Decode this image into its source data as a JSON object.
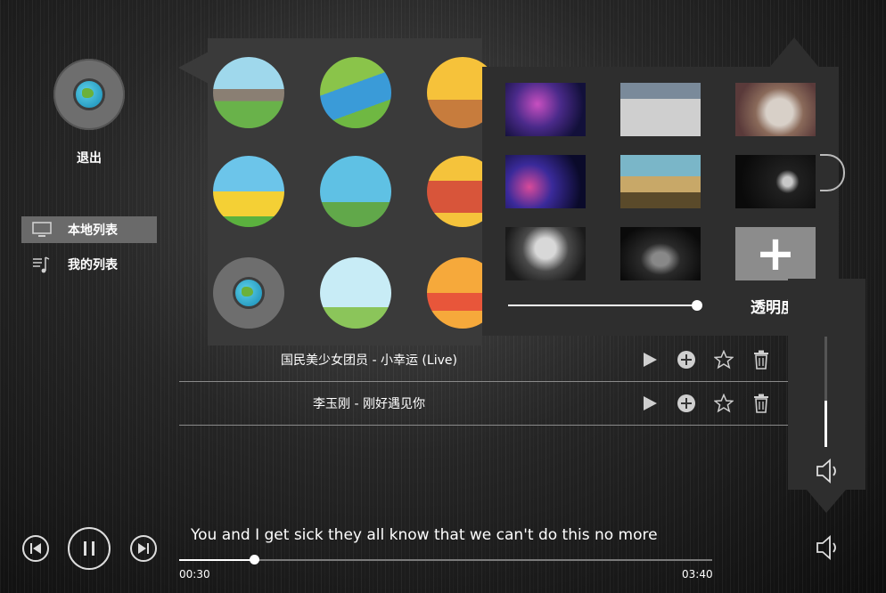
{
  "sidebar": {
    "exit_label": "退出",
    "items": [
      {
        "label": "本地列表",
        "icon": "monitor-icon",
        "active": true
      },
      {
        "label": "我的列表",
        "icon": "playlist-icon",
        "active": false
      }
    ]
  },
  "icon_picker": {
    "icons": [
      "landscape-icon",
      "river-icon",
      "cyclist-icon",
      "castle-icon",
      "parachute-icon",
      "camera-icon",
      "globe-icon",
      "hotel-icon",
      "sunset-icon"
    ]
  },
  "wallpaper_picker": {
    "thumbnails": [
      "galaxy-pink",
      "pier-boardwalk",
      "kitten",
      "galaxy-blue",
      "beach-grass",
      "dark-portrait",
      "anime-character",
      "sports-car"
    ],
    "add_label": "+",
    "opacity_label": "透明度",
    "opacity_value": 1.0
  },
  "songs": [
    {
      "title": "国民美少女团员 - 小幸运 (Live)"
    },
    {
      "title": "李玉刚 - 刚好遇见你"
    }
  ],
  "volume": {
    "level": 0.42
  },
  "player": {
    "lyric": "You and I get sick  they all know that we can't do this no more",
    "current_time": "00:30",
    "total_time": "03:40",
    "progress": 0.14
  },
  "colors": {
    "panel": "#3a3a3a",
    "active_item": "#6a6a6a",
    "accent": "#ffffff"
  }
}
